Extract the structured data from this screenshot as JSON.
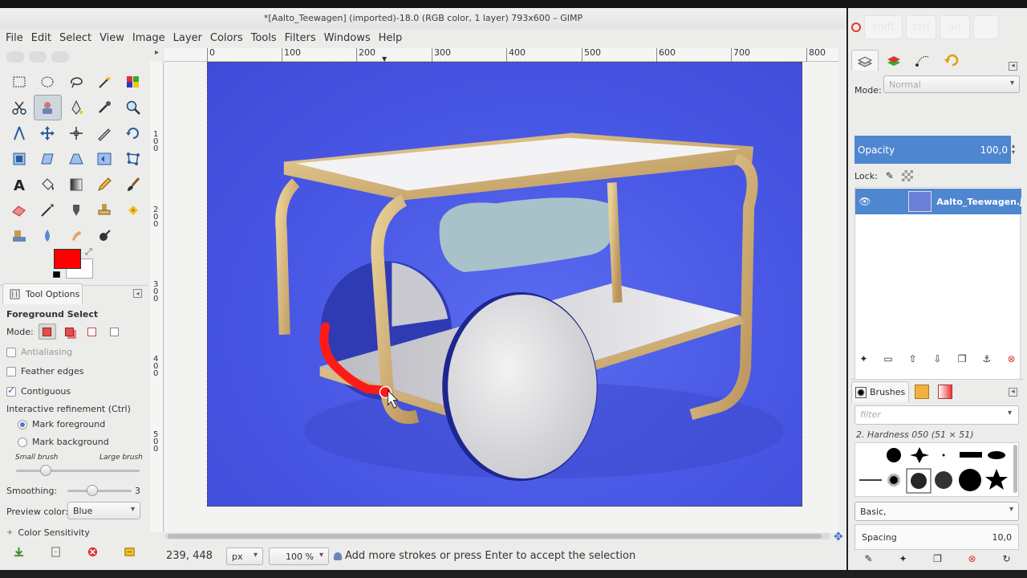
{
  "window": {
    "title": "*[Aalto_Teewagen] (imported)-18.0 (RGB color, 1 layer) 793x600 – GIMP"
  },
  "menubar": [
    "File",
    "Edit",
    "Select",
    "View",
    "Image",
    "Layer",
    "Colors",
    "Tools",
    "Filters",
    "Windows",
    "Help"
  ],
  "colors": {
    "foreground": "#ff0000",
    "background": "#ffffff",
    "accent": "#4f86d0",
    "canvas_bg": "#4a5ae6"
  },
  "tool_options": {
    "tab_label": "Tool Options",
    "tool_name": "Foreground Select",
    "mode_label": "Mode:",
    "antialiasing": "Antialiasing",
    "feather_edges": "Feather edges",
    "contiguous": "Contiguous",
    "interactive_refinement": "Interactive refinement  (Ctrl)",
    "mark_foreground": "Mark foreground",
    "mark_background": "Mark background",
    "small_brush": "Small brush",
    "large_brush": "Large brush",
    "smoothing_label": "Smoothing:",
    "smoothing_value": "3",
    "preview_color_label": "Preview color:",
    "preview_color_value": "Blue",
    "color_sensitivity": "Color Sensitivity"
  },
  "ruler": {
    "h_labels": [
      "0",
      "100",
      "200",
      "300",
      "400",
      "500",
      "600",
      "700",
      "800"
    ],
    "v_labels": [
      "100",
      "200",
      "300",
      "400",
      "500"
    ]
  },
  "status": {
    "coords": "239, 448",
    "unit": "px",
    "zoom": "100 %",
    "message": "Add more strokes or press Enter to accept the selection"
  },
  "keys": [
    "shift",
    "ctrl",
    "alt"
  ],
  "layers": {
    "mode_label": "Mode:",
    "mode_value": "Normal",
    "opacity_label": "Opacity",
    "opacity_value": "100,0",
    "lock_label": "Lock:",
    "layer_name": "Aalto_Teewagen.jp"
  },
  "brushes": {
    "tab_label": "Brushes",
    "filter_placeholder": "filter",
    "brush_name": "2. Hardness 050 (51 × 51)",
    "tag": "Basic,",
    "spacing_label": "Spacing",
    "spacing_value": "10,0"
  }
}
